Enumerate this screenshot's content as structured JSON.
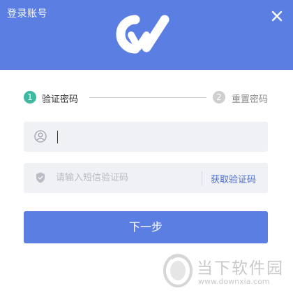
{
  "window": {
    "title": "登录账号"
  },
  "steps": [
    {
      "number": "1",
      "label": "验证密码"
    },
    {
      "number": "2",
      "label": "重置密码"
    }
  ],
  "username_field": {
    "value": "",
    "placeholder": ""
  },
  "code_field": {
    "value": "",
    "placeholder": "请输入短信验证码",
    "get_code_label": "获取验证码"
  },
  "actions": {
    "next_label": "下一步"
  },
  "watermark": {
    "text": "当下软件园",
    "url": "www.downxia.com"
  },
  "colors": {
    "primary": "#5b7ee3",
    "step_active": "#3cb9a0",
    "step_inactive": "#cfcfcf",
    "link": "#4a6bd0"
  }
}
